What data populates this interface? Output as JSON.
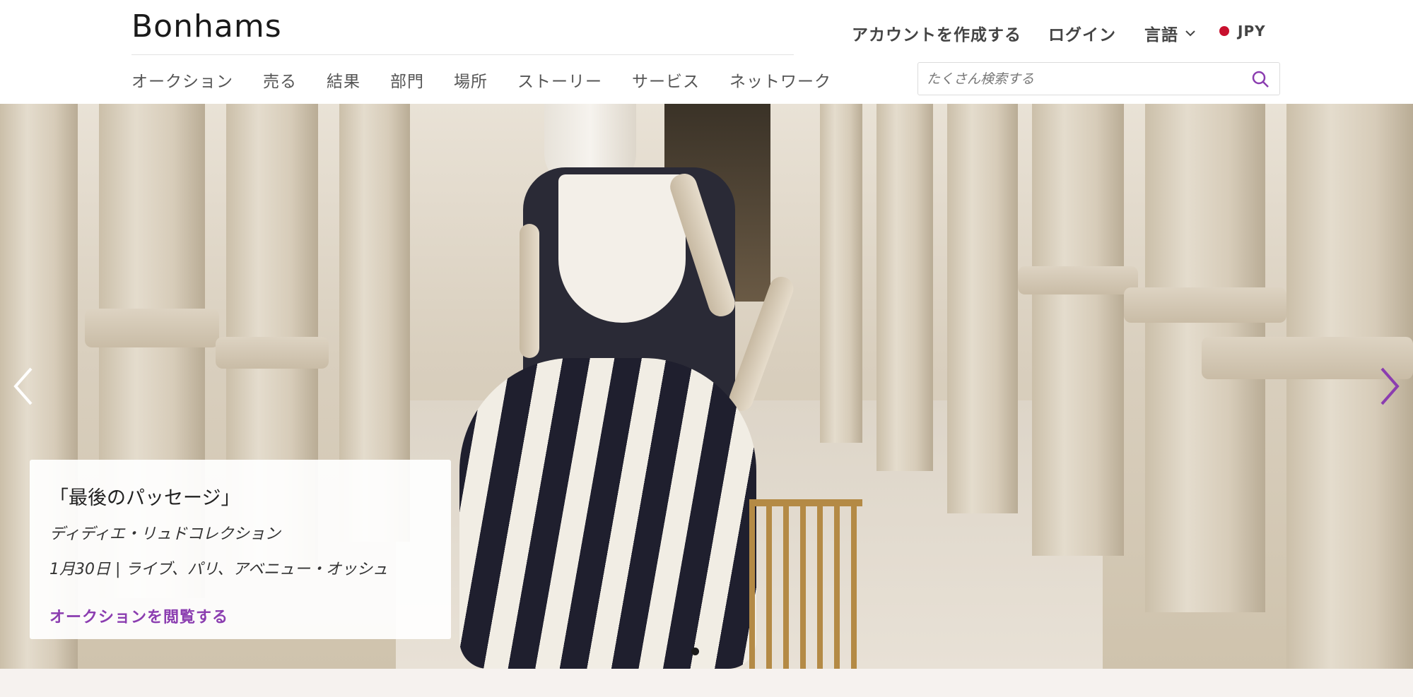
{
  "header": {
    "logo": "Bonhams",
    "create_account": "アカウントを作成する",
    "login": "ログイン",
    "language": "言語",
    "currency": "JPY"
  },
  "nav": {
    "items": [
      {
        "label": "オークション"
      },
      {
        "label": "売る"
      },
      {
        "label": "結果"
      },
      {
        "label": "部門"
      },
      {
        "label": "場所"
      },
      {
        "label": "ストーリー"
      },
      {
        "label": "サービス"
      },
      {
        "label": "ネットワーク"
      }
    ]
  },
  "search": {
    "placeholder": "たくさん検索する"
  },
  "hero": {
    "title": "「最後のパッセージ」",
    "subtitle": "ディディエ・リュドコレクション",
    "date_line": "1月30日 | ライブ、パリ、アベニュー・オッシュ",
    "cta": "オークションを閲覧する"
  },
  "colors": {
    "accent": "#8b3db0",
    "currency_dot": "#c8102e"
  },
  "icons": {
    "search": "search-icon",
    "chevron": "chevron-down-icon",
    "prev": "chevron-left-icon",
    "next": "chevron-right-icon"
  }
}
